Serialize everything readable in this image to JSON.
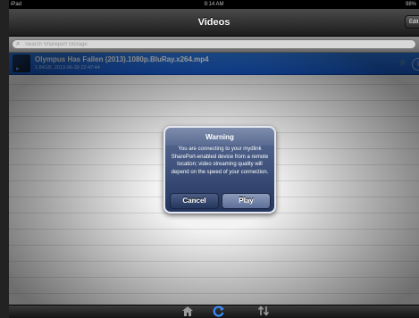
{
  "status_bar": {
    "device": "iPad",
    "time": "9:14 AM",
    "battery": "98%"
  },
  "nav": {
    "title": "Videos",
    "edit_label": "Edit"
  },
  "search": {
    "placeholder": "Search Shareport Storage"
  },
  "list": {
    "items": [
      {
        "name": "Olympus Has Fallen (2013).1080p.BluRay.x264.mp4",
        "meta": "1.84GB, 2013-06-30 22:47:44",
        "selected": true
      }
    ]
  },
  "alert": {
    "title": "Warning",
    "message": "You are connecting to your mydlink SharePort-enabled device from a remote location; video streaming quality will depend on the speed of your connection.",
    "cancel_label": "Cancel",
    "play_label": "Play"
  },
  "tabbar": {
    "icons": [
      "home-icon",
      "refresh-icon",
      "transfer-icon"
    ]
  },
  "colors": {
    "selected_row": "#1f66d6",
    "alert_bg": "#34466f",
    "refresh_active": "#3b8cff"
  }
}
